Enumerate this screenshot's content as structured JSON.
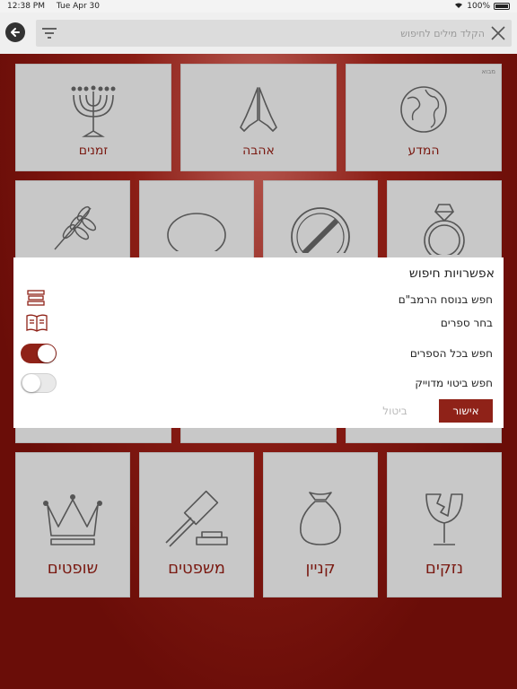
{
  "status_bar": {
    "time": "12:38 PM",
    "date": "Tue Apr 30",
    "battery": "100%"
  },
  "search": {
    "placeholder": "הקלד מילים לחיפוש"
  },
  "tiles_row1": [
    {
      "label": "זמנים",
      "icon": "menorah-icon"
    },
    {
      "label": "אהבה",
      "icon": "praying-hands-icon"
    },
    {
      "label": "המדע",
      "icon": "globe-icon",
      "corner": "מבוא"
    }
  ],
  "tiles_bottom": [
    {
      "label": "שופטים",
      "icon": "crown-icon"
    },
    {
      "label": "משפטים",
      "icon": "gavel-icon"
    },
    {
      "label": "קניין",
      "icon": "money-bag-icon"
    },
    {
      "label": "נזקים",
      "icon": "broken-glass-icon"
    }
  ],
  "modal": {
    "title": "אפשרויות חיפוש",
    "options": [
      {
        "label": "חפש בנוסח הרמב\"ם",
        "icon": "books-icon"
      },
      {
        "label": "בחר ספרים",
        "icon": "open-book-icon"
      },
      {
        "label": "חפש בכל הספרים",
        "toggle": true
      },
      {
        "label": "חפש ביטוי מדוייק",
        "toggle": false
      }
    ],
    "ok_label": "אישור",
    "cancel_label": "ביטול"
  }
}
